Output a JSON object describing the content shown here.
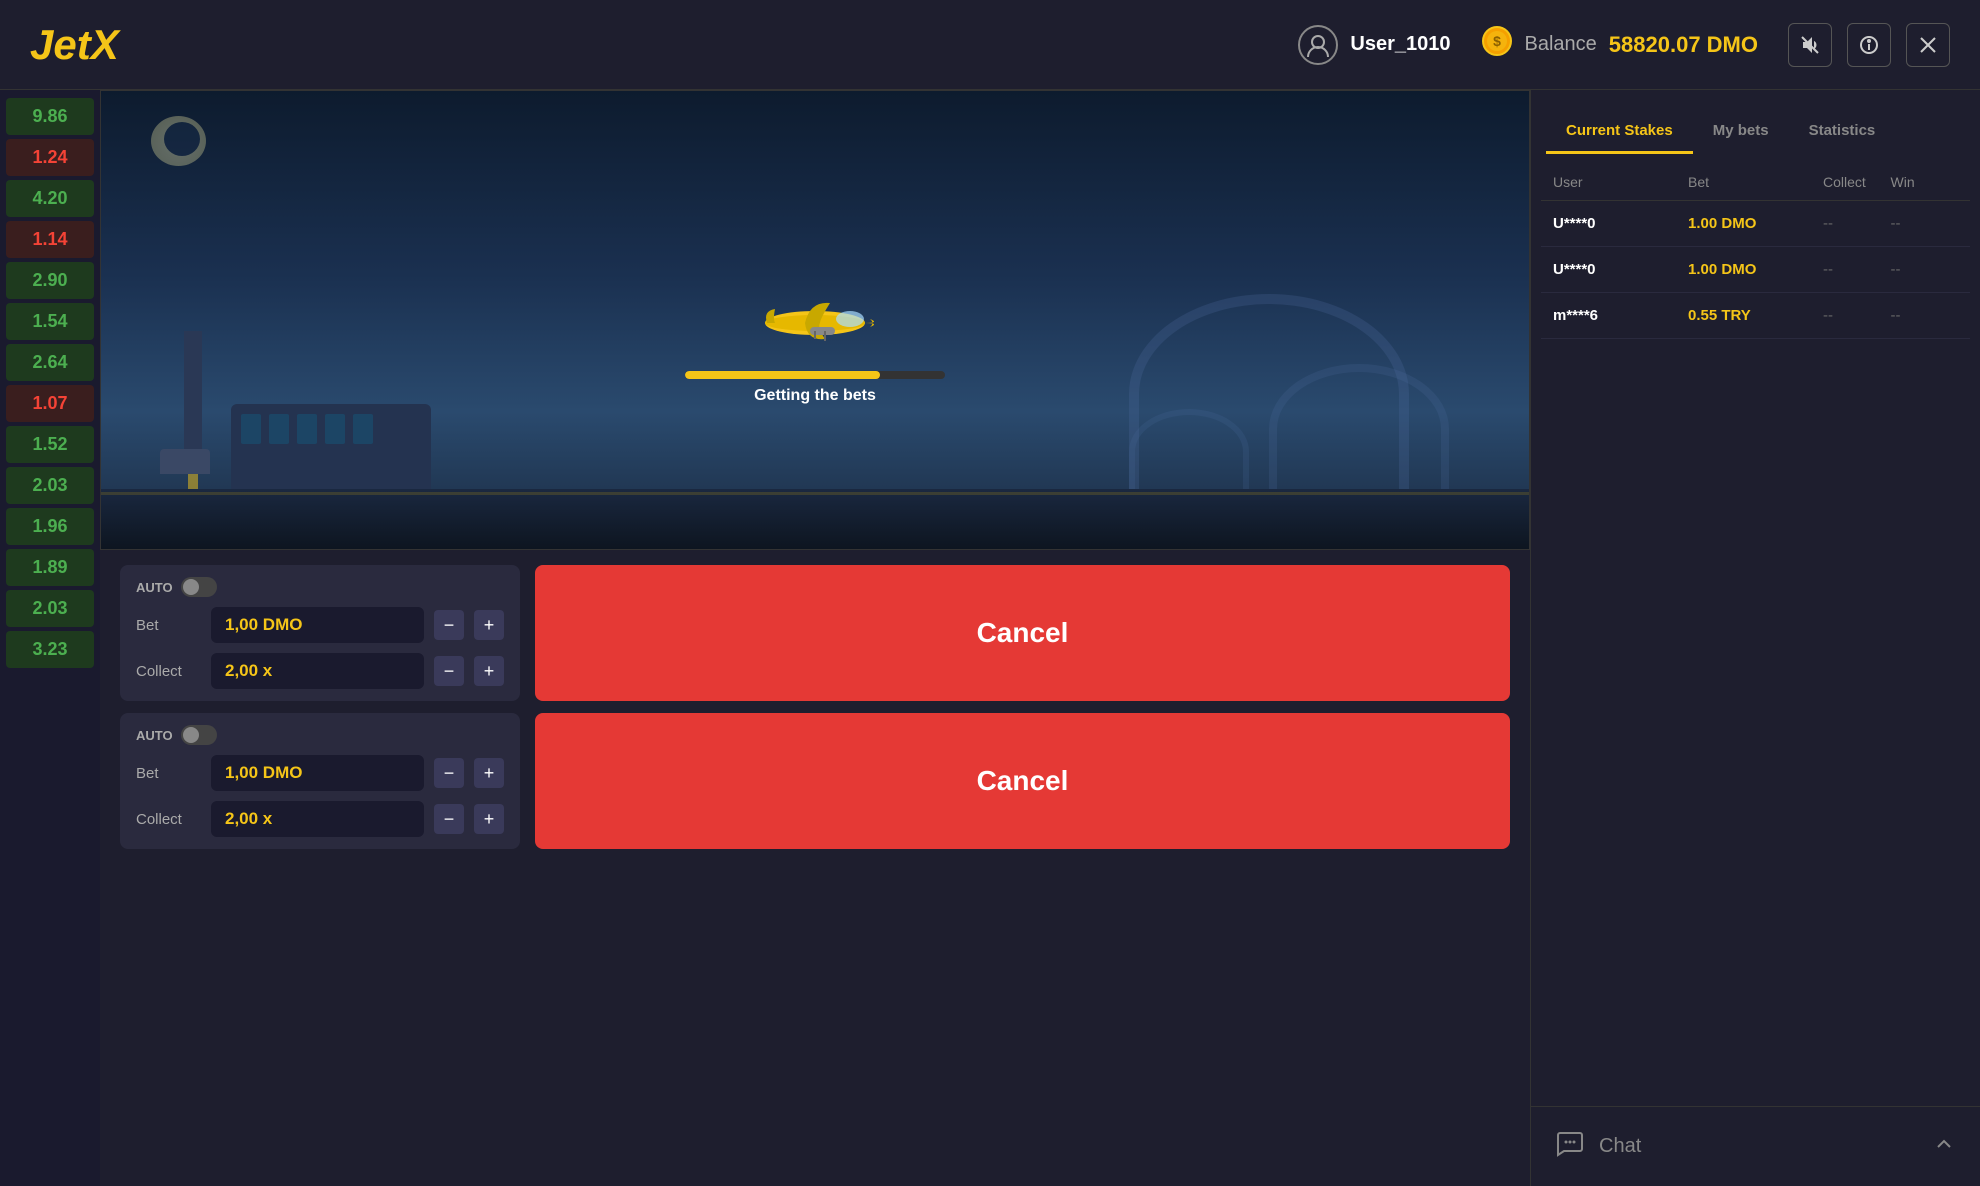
{
  "header": {
    "logo_j": "Jet",
    "logo_x": "X",
    "user_icon": "👤",
    "username": "User_1010",
    "balance_label": "Balance",
    "balance_value": "58820.07 DMO",
    "coin_icon": "🪙",
    "icon_sound": "🔇",
    "icon_info": "ℹ",
    "icon_close": "✕"
  },
  "left_sidebar": {
    "multipliers": [
      {
        "value": "9.86",
        "type": "green"
      },
      {
        "value": "1.24",
        "type": "red"
      },
      {
        "value": "4.20",
        "type": "green"
      },
      {
        "value": "1.14",
        "type": "red"
      },
      {
        "value": "2.90",
        "type": "green"
      },
      {
        "value": "1.54",
        "type": "green"
      },
      {
        "value": "2.64",
        "type": "green"
      },
      {
        "value": "1.07",
        "type": "red"
      },
      {
        "value": "1.52",
        "type": "green"
      },
      {
        "value": "2.03",
        "type": "green"
      },
      {
        "value": "1.96",
        "type": "green"
      },
      {
        "value": "1.89",
        "type": "green"
      },
      {
        "value": "2.03",
        "type": "green"
      },
      {
        "value": "3.23",
        "type": "green"
      }
    ]
  },
  "game": {
    "status": "Getting the bets",
    "progress": 75
  },
  "tabs": {
    "current_stakes": "Current Stakes",
    "my_bets": "My bets",
    "statistics": "Statistics"
  },
  "table": {
    "headers": {
      "user": "User",
      "bet": "Bet",
      "collect": "Collect",
      "win": "Win"
    },
    "rows": [
      {
        "user": "U****0",
        "bet": "1.00 DMO",
        "collect": "--",
        "win": "--"
      },
      {
        "user": "U****0",
        "bet": "1.00 DMO",
        "collect": "--",
        "win": "--"
      },
      {
        "user": "m****6",
        "bet": "0.55 TRY",
        "collect": "--",
        "win": "--"
      }
    ]
  },
  "bet_panel_1": {
    "auto_label": "AUTO",
    "bet_label": "Bet",
    "bet_value": "1,00 DMO",
    "collect_label": "Collect",
    "collect_value": "2,00 x",
    "cancel_label": "Cancel"
  },
  "bet_panel_2": {
    "auto_label": "AUTO",
    "bet_label": "Bet",
    "bet_value": "1,00 DMO",
    "collect_label": "Collect",
    "collect_value": "2,00 x",
    "cancel_label": "Cancel"
  },
  "chat": {
    "label": "Chat",
    "icon": "💬"
  }
}
